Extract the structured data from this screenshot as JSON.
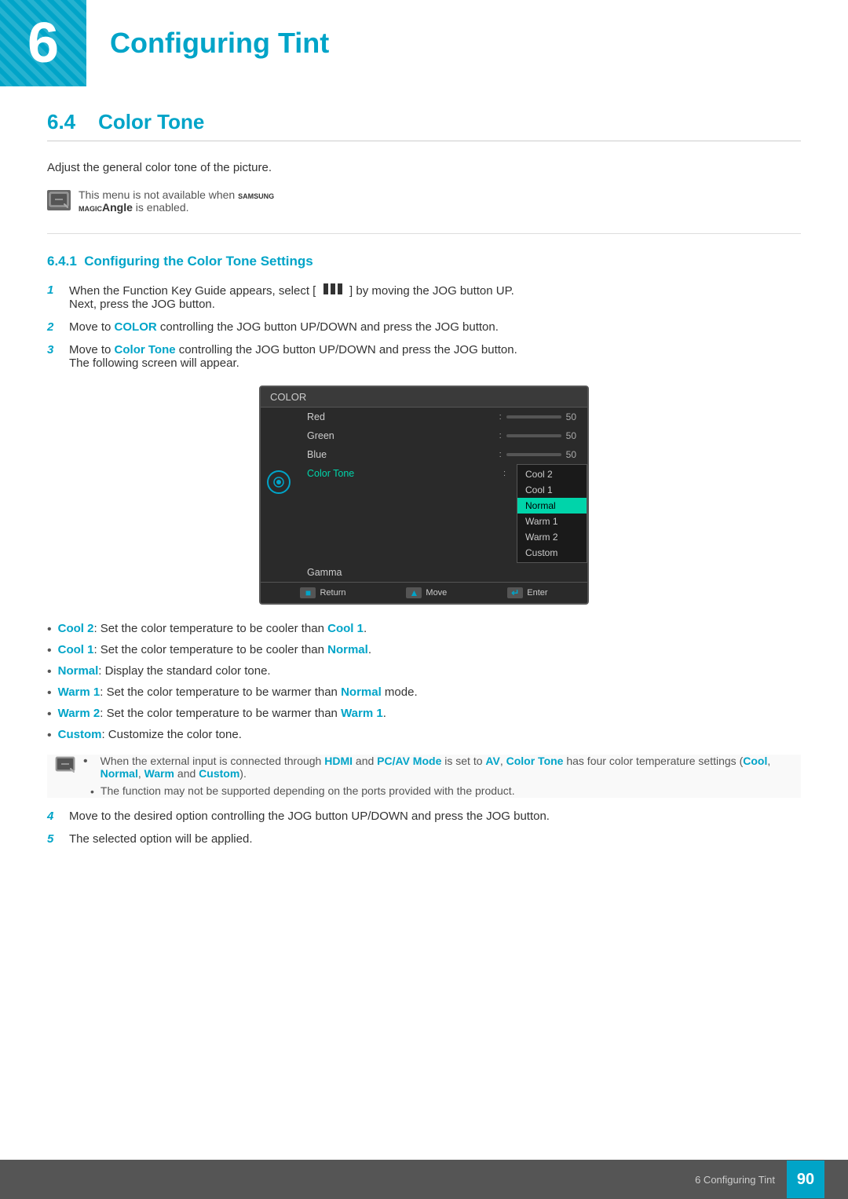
{
  "chapter": {
    "number": "6",
    "title": "Configuring Tint",
    "color": "#00a4c8"
  },
  "section": {
    "number": "6.4",
    "title": "Color Tone",
    "intro": "Adjust the general color tone of the picture.",
    "note": "This menu is not available when ",
    "note_brand": "SAMSUNG MAGIC",
    "note_angle": "Angle",
    "note_end": " is enabled.",
    "subsection": {
      "number": "6.4.1",
      "title": "Configuring the Color Tone Settings"
    }
  },
  "steps": [
    {
      "number": "1",
      "text": "When the Function Key Guide appears, select [ ",
      "icon": "grid-icon",
      "text_end": " ] by moving the JOG button UP. Next, press the JOG button."
    },
    {
      "number": "2",
      "text": "Move to ",
      "bold": "COLOR",
      "text_end": " controlling the JOG button UP/DOWN and press the JOG button."
    },
    {
      "number": "3",
      "text": "Move to ",
      "bold": "Color Tone",
      "text_end": " controlling the JOG button UP/DOWN and press the JOG button. The following screen will appear."
    }
  ],
  "monitor": {
    "title": "COLOR",
    "menu_items": [
      {
        "label": "Red",
        "value": "50",
        "has_slider": true
      },
      {
        "label": "Green",
        "value": "50",
        "has_slider": true
      },
      {
        "label": "Blue",
        "value": "50",
        "has_slider": true
      },
      {
        "label": "Color Tone",
        "active": true,
        "has_submenu": true
      },
      {
        "label": "Gamma",
        "has_submenu": false
      }
    ],
    "submenu": [
      {
        "label": "Cool 2",
        "active": false
      },
      {
        "label": "Cool 1",
        "active": false
      },
      {
        "label": "Normal",
        "active": true
      },
      {
        "label": "Warm 1",
        "active": false
      },
      {
        "label": "Warm 2",
        "active": false
      },
      {
        "label": "Custom",
        "active": false
      }
    ],
    "footer_buttons": [
      {
        "icon": "return-icon",
        "label": "Return"
      },
      {
        "icon": "move-icon",
        "label": "Move"
      },
      {
        "icon": "enter-icon",
        "label": "Enter"
      }
    ]
  },
  "bullets": [
    {
      "bold_label": "Cool 2",
      "text": ": Set the color temperature to be cooler than ",
      "bold_ref": "Cool 1",
      "text_end": "."
    },
    {
      "bold_label": "Cool 1",
      "text": ": Set the color temperature to be cooler than ",
      "bold_ref": "Normal",
      "text_end": "."
    },
    {
      "bold_label": "Normal",
      "text": ": Display the standard color tone.",
      "bold_ref": "",
      "text_end": ""
    },
    {
      "bold_label": "Warm 1",
      "text": ": Set the color temperature to be warmer than ",
      "bold_ref": "Normal",
      "text_end": " mode."
    },
    {
      "bold_label": "Warm 2",
      "text": ": Set the color temperature to be warmer than ",
      "bold_ref": "Warm 1",
      "text_end": "."
    },
    {
      "bold_label": "Custom",
      "text": ": Customize the color tone.",
      "bold_ref": "",
      "text_end": ""
    }
  ],
  "nested_note": {
    "text_1": "When the external input is connected through ",
    "bold_1": "HDMI",
    "text_2": " and ",
    "bold_2": "PC/AV Mode",
    "text_3": " is set to ",
    "bold_3": "AV",
    "text_4": ", ",
    "bold_4": "Color Tone",
    "text_5": " has four color temperature settings (",
    "bold_5a": "Cool",
    "text_5b": ", ",
    "bold_5b": "Normal",
    "text_5c": ", ",
    "bold_5c": "Warm",
    "text_5d": " and ",
    "bold_5d": "Custom",
    "text_5e": ").",
    "sub_note": "The function may not be supported depending on the ports provided with the product."
  },
  "steps_after": [
    {
      "number": "4",
      "text": "Move to the desired option controlling the JOG button UP/DOWN and press the JOG button."
    },
    {
      "number": "5",
      "text": "The selected option will be applied."
    }
  ],
  "footer": {
    "chapter_text": "6 Configuring Tint",
    "page_number": "90"
  }
}
